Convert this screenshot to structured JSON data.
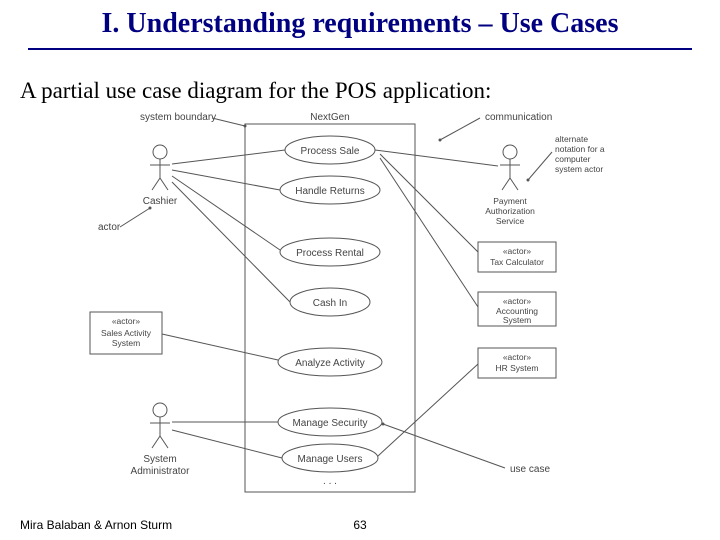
{
  "title": "I. Understanding requirements – Use Cases",
  "subtitle": "A partial use case diagram for the POS application:",
  "footer": {
    "authors": "Mira Balaban  &  Arnon Sturm",
    "page": "63"
  },
  "diagram": {
    "system_name": "NextGen",
    "annotations": {
      "system_boundary": "system boundary",
      "communication": "communication",
      "alt_notation": "alternate notation for a computer system actor",
      "actor_callout": "actor",
      "usecase_callout": "use case"
    },
    "actors_left": [
      {
        "name": "Cashier"
      },
      {
        "name": "System Administrator"
      }
    ],
    "actors_right": [
      {
        "name": "Payment Authorization Service",
        "type": "stick"
      },
      {
        "name": "Tax Calculator",
        "stereotype": "«actor»"
      },
      {
        "name": "Accounting System",
        "stereotype": "«actor»"
      },
      {
        "name": "HR System",
        "stereotype": "«actor»"
      }
    ],
    "sales_activity": {
      "stereotype": "«actor»",
      "name": "Sales Activity System"
    },
    "usecases": [
      "Process Sale",
      "Handle Returns",
      "Process Rental",
      "Cash In",
      "Analyze Activity",
      "Manage Security",
      "Manage Users"
    ],
    "ellipsis": ". . ."
  }
}
